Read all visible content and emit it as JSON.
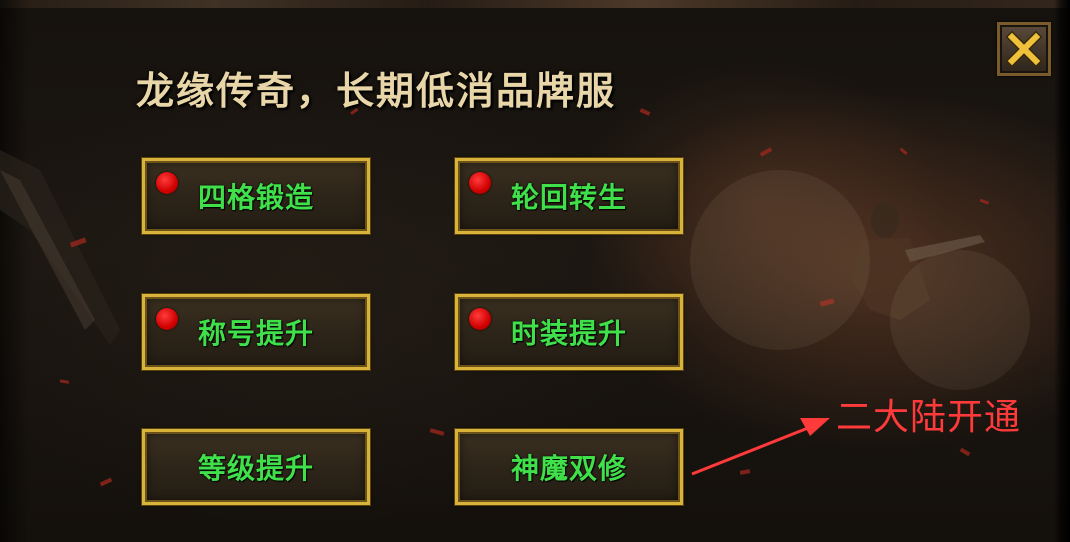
{
  "title": "龙缘传奇，长期低消品牌服",
  "close_icon": "close-icon",
  "buttons": [
    {
      "label": "四格锻造",
      "notify": true
    },
    {
      "label": "轮回转生",
      "notify": true
    },
    {
      "label": "称号提升",
      "notify": true
    },
    {
      "label": "时装提升",
      "notify": true
    },
    {
      "label": "等级提升",
      "notify": false
    },
    {
      "label": "神魔双修",
      "notify": false
    }
  ],
  "annotation": {
    "text": "二大陆开通",
    "color": "#ff3a3a"
  },
  "colors": {
    "button_border": "#d9b23a",
    "button_label": "#3fe04a",
    "notify_dot": "#e00000",
    "title": "#e9d6a8"
  }
}
